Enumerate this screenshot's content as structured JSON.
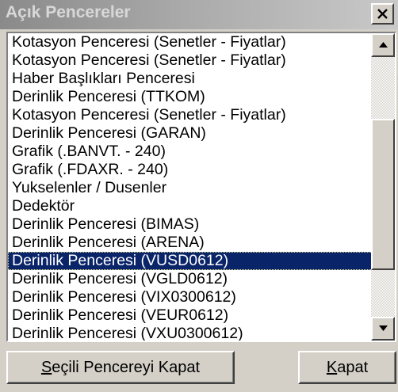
{
  "window": {
    "title": "Açık Pencereler",
    "close_glyph": "×"
  },
  "list": {
    "items": [
      "Kotasyon Penceresi (Senetler - Fiyatlar)",
      "Kotasyon Penceresi (Senetler - Fiyatlar)",
      "Haber Başlıkları Penceresi",
      "Derinlik Penceresi (TTKOM)",
      "Kotasyon Penceresi (Senetler - Fiyatlar)",
      "Derinlik Penceresi (GARAN)",
      "Grafik (.BANVT. - 240)",
      "Grafik (.FDAXR. - 240)",
      "Yukselenler / Dusenler",
      "Dedektör",
      "Derinlik Penceresi (BIMAS)",
      "Derinlik Penceresi (ARENA)",
      "Derinlik Penceresi (VUSD0612)",
      "Derinlik Penceresi (VGLD0612)",
      "Derinlik Penceresi (VIX0300612)",
      "Derinlik Penceresi (VEUR0612)",
      "Derinlik Penceresi (VXU0300612)"
    ],
    "selected_index": 12
  },
  "buttons": {
    "close_selected": {
      "mnemonic": "S",
      "rest": "eçili Pencereyi Kapat"
    },
    "close": {
      "mnemonic": "K",
      "rest": "apat"
    }
  },
  "colors": {
    "selection": "#0a246a",
    "face": "#d4d0c8"
  },
  "icons": {
    "title_close": "close-icon",
    "scroll_up": "arrow-up-icon",
    "scroll_down": "arrow-down-icon"
  }
}
